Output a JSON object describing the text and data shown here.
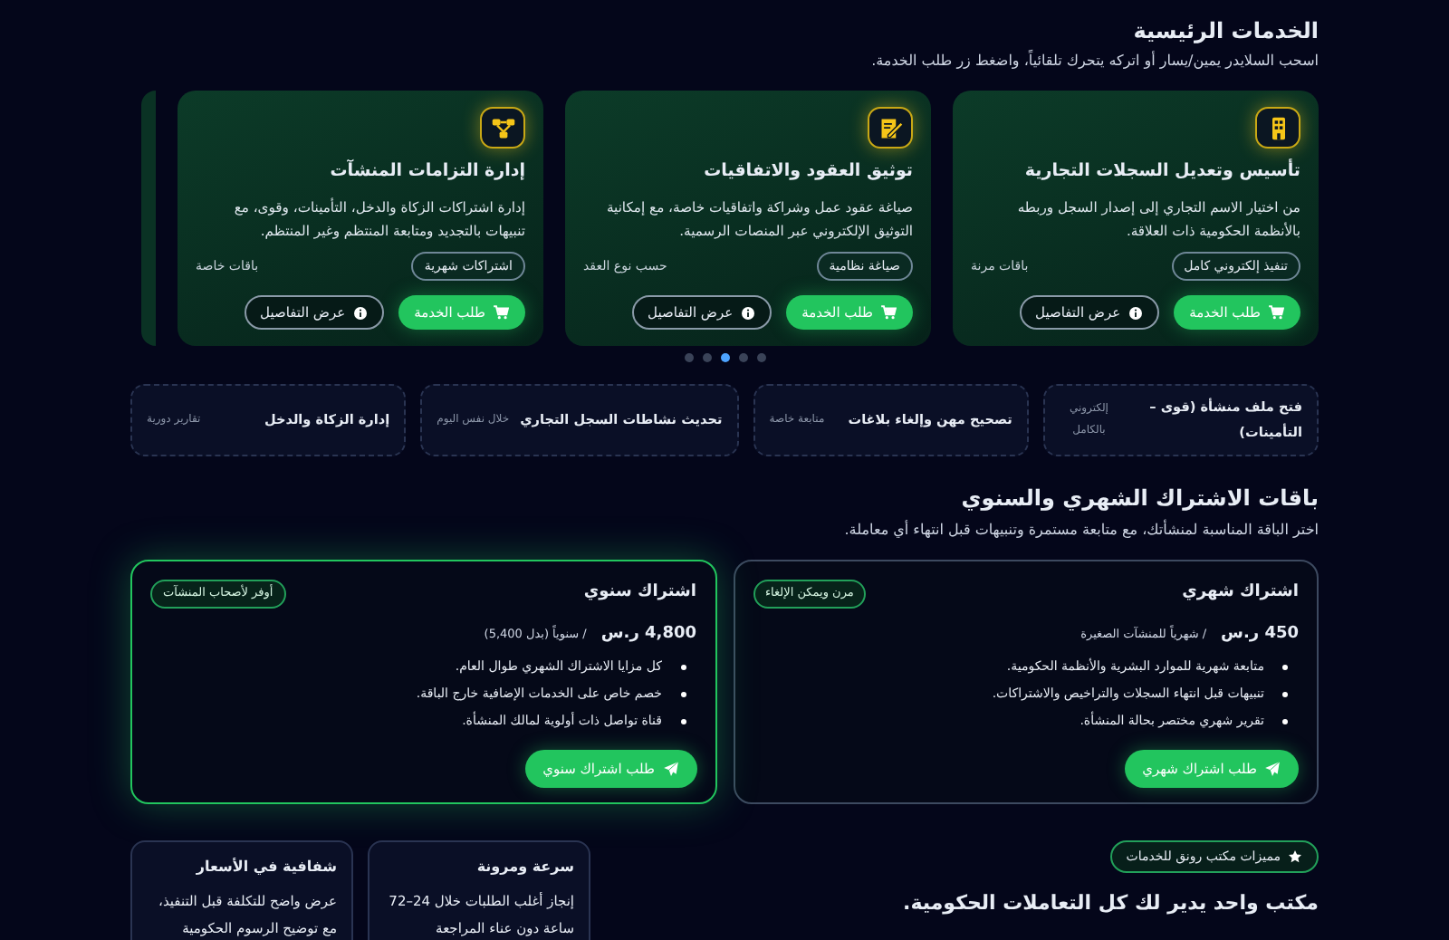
{
  "services": {
    "title": "الخدمات الرئيسية",
    "subtitle": "اسحب السلايدر يمين/يسار أو اتركه يتحرك تلقائياً، واضغط زر طلب الخدمة.",
    "cards": [
      {
        "title": "تأسيس وتعديل السجلات التجارية",
        "description": "من اختيار الاسم التجاري إلى إصدار السجل وربطه بالأنظمة الحكومية ذات العلاقة.",
        "tag": "تنفيذ إلكتروني كامل",
        "note": "باقات مرنة",
        "request_button": "طلب الخدمة",
        "details_button": "عرض التفاصيل"
      },
      {
        "title": "توثيق العقود والاتفاقيات",
        "description": "صياغة عقود عمل وشراكة واتفاقيات خاصة، مع إمكانية التوثيق الإلكتروني عبر المنصات الرسمية.",
        "tag": "صياغة نظامية",
        "note": "حسب نوع العقد",
        "request_button": "طلب الخدمة",
        "details_button": "عرض التفاصيل"
      },
      {
        "title": "إدارة التزامات المنشآت",
        "description": "إدارة اشتراكات الزكاة والدخل، التأمينات، وقوى، مع تنبيهات بالتجديد ومتابعة المنتظم وغير المنتظم.",
        "tag": "اشتراكات شهرية",
        "note": "باقات خاصة",
        "request_button": "طلب الخدمة",
        "details_button": "عرض التفاصيل"
      }
    ],
    "dots": [
      {
        "selected": false
      },
      {
        "selected": false
      },
      {
        "selected": true
      },
      {
        "selected": false
      },
      {
        "selected": false
      }
    ]
  },
  "quick_services": [
    {
      "title": "فتح ملف منشأة (قوى – التأمينات)",
      "note": "إلكتروني بالكامل"
    },
    {
      "title": "تصحيح مهن وإلغاء بلاغات",
      "note": "متابعة خاصة"
    },
    {
      "title": "تحديث نشاطات السجل التجاري",
      "note": "خلال نفس اليوم"
    },
    {
      "title": "إدارة الزكاة والدخل",
      "note": "تقارير دورية"
    }
  ],
  "plans": {
    "title": "باقات الاشتراك الشهري والسنوي",
    "subtitle": "اختر الباقة المناسبة لمنشأتك، مع متابعة مستمرة وتنبيهات قبل انتهاء أي معاملة.",
    "items": [
      {
        "name": "اشتراك شهري",
        "badge": "مرن ويمكن الإلغاء",
        "price": "450 ر.س",
        "period": "/ شهرياً للمنشآت الصغيرة",
        "features": [
          "متابعة شهرية للموارد البشرية والأنظمة الحكومية.",
          "تنبيهات قبل انتهاء السجلات والتراخيص والاشتراكات.",
          "تقرير شهري مختصر بحالة المنشأة."
        ],
        "button": "طلب اشتراك شهري",
        "featured": false
      },
      {
        "name": "اشتراك سنوي",
        "badge": "أوفر لأصحاب المنشآت",
        "price": "4,800 ر.س",
        "period": "/ سنوياً (بدل 5,400)",
        "features": [
          "كل مزايا الاشتراك الشهري طوال العام.",
          "خصم خاص على الخدمات الإضافية خارج الباقة.",
          "قناة تواصل ذات أولوية لمالك المنشأة."
        ],
        "button": "طلب اشتراك سنوي",
        "featured": true
      }
    ]
  },
  "features": {
    "badge": "مميزات مكتب رونق للخدمات",
    "heading": "مكتب واحد يدير لك كل التعاملات الحكومية.",
    "cards": [
      {
        "title": "سرعة ومرونة",
        "lines": [
          "إنجاز أغلب الطلبات خلال 24–72",
          "ساعة دون عناء المراجعة"
        ]
      },
      {
        "title": "شفافية في الأسعار",
        "lines": [
          "عرض واضح للتكلفة قبل التنفيذ،",
          "مع توضيح الرسوم الحكومية"
        ]
      }
    ]
  }
}
